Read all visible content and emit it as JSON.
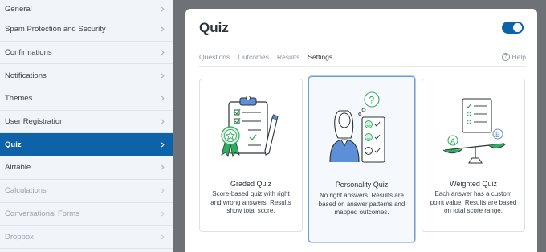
{
  "sidebar": {
    "items": [
      {
        "label": "General",
        "state": "normal"
      },
      {
        "label": "Spam Protection and Security",
        "state": "normal"
      },
      {
        "label": "Confirmations",
        "state": "normal"
      },
      {
        "label": "Notifications",
        "state": "normal"
      },
      {
        "label": "Themes",
        "state": "normal"
      },
      {
        "label": "User Registration",
        "state": "normal"
      },
      {
        "label": "Quiz",
        "state": "active"
      },
      {
        "label": "Airtable",
        "state": "normal"
      },
      {
        "label": "Calculations",
        "state": "disabled"
      },
      {
        "label": "Conversational Forms",
        "state": "disabled"
      },
      {
        "label": "Dropbox",
        "state": "disabled"
      }
    ]
  },
  "panel": {
    "title": "Quiz",
    "toggle_on": true,
    "tabs": [
      {
        "label": "Questions",
        "active": false
      },
      {
        "label": "Outcomes",
        "active": false
      },
      {
        "label": "Results",
        "active": false
      },
      {
        "label": "Settings",
        "active": true
      }
    ],
    "help_label": "Help",
    "help_icon": "question-circle-icon"
  },
  "cards": [
    {
      "title": "Graded Quiz",
      "description": "Score-based quiz with right and wrong answers. Results show total score.",
      "selected": false,
      "icon": "clipboard-award-icon"
    },
    {
      "title": "Personality Quiz",
      "description": "No right answers. Results are based on answer patterns and mapped outcomes.",
      "selected": true,
      "icon": "person-mood-icon"
    },
    {
      "title": "Weighted Quiz",
      "description": "Each answer has a custom point value. Results are based on total score range.",
      "selected": false,
      "icon": "balance-scale-icon"
    }
  ],
  "colors": {
    "accent": "#0e63a8",
    "tab_underline": "#e27730",
    "illustration_green": "#2fae60"
  }
}
